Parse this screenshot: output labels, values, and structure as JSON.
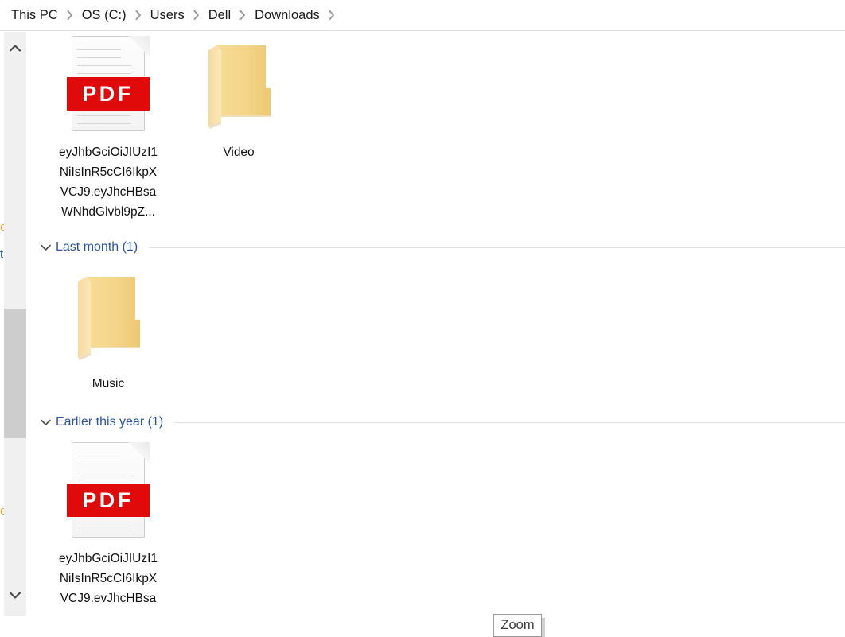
{
  "breadcrumb": {
    "separator_icon": "chevron-right-icon",
    "items": [
      {
        "label": "This PC"
      },
      {
        "label": "OS (C:)"
      },
      {
        "label": "Users"
      },
      {
        "label": "Dell"
      },
      {
        "label": "Downloads"
      }
    ]
  },
  "scrollbar": {
    "up_arrow_icon": "chevron-up-icon",
    "down_arrow_icon": "chevron-down-icon",
    "orientation": "vertical",
    "thumb_color": "#cdcdcd",
    "track_color": "#f0f0f0"
  },
  "nav_pane_fragments": [
    {
      "text": "e",
      "color": "#e8a33d"
    },
    {
      "text": "t",
      "color": "#2a5aa8"
    },
    {
      "text": "e",
      "color": "#e8a33d"
    }
  ],
  "content": {
    "groups": [
      {
        "header": null,
        "items": [
          {
            "icon": "pdf-file-icon",
            "icon_badge_text": "PDF",
            "label": "eyJhbGciOiJIUzI1\nNiIsInR5cCI6IkpX\nVCJ9.eyJhcHBsa\nWNhdGlvbl9pZ...",
            "type": "file"
          },
          {
            "icon": "folder-icon",
            "label": "Video",
            "type": "folder"
          }
        ]
      },
      {
        "header": {
          "title": "Last month (1)",
          "chevron_icon": "chevron-down-icon",
          "expanded": true
        },
        "items": [
          {
            "icon": "folder-icon",
            "label": "Music",
            "type": "folder"
          }
        ]
      },
      {
        "header": {
          "title": "Earlier this year (1)",
          "chevron_icon": "chevron-down-icon",
          "expanded": true
        },
        "items": [
          {
            "icon": "pdf-file-icon",
            "icon_badge_text": "PDF",
            "label": "eyJhbGciOiJIUzI1\nNiIsInR5cCI6IkpX\nVCJ9.evJhcHBsa",
            "type": "file"
          }
        ]
      }
    ]
  },
  "status_bar": {
    "zoom_label": "Zoom"
  },
  "colors": {
    "group_header_blue": "#2a53a8",
    "pdf_red": "#e10a0a",
    "folder_yellow": "#f6d88b",
    "scrollbar_thumb": "#cdcdcd"
  }
}
